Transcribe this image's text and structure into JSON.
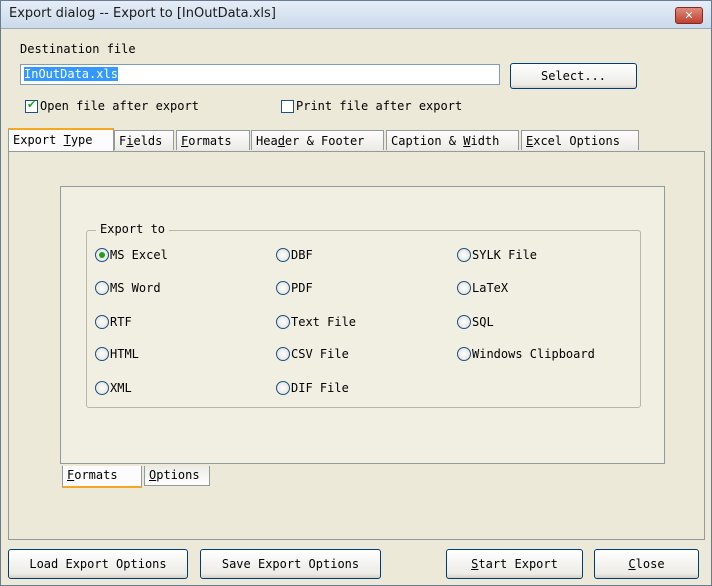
{
  "window": {
    "title": "Export dialog -- Export to [InOutData.xls]",
    "close_glyph": "✕"
  },
  "destination": {
    "label": "Destination file",
    "value": "InOutData.xls",
    "select_button": "Select..."
  },
  "options": {
    "open_after": {
      "label": "Open file after export",
      "checked": true
    },
    "print_after": {
      "label": "Print file after export",
      "checked": false
    }
  },
  "tabs": [
    {
      "pre": "Export ",
      "ul": "T",
      "post": "ype",
      "active": true
    },
    {
      "pre": "F",
      "ul": "i",
      "post": "elds",
      "active": false
    },
    {
      "pre": "",
      "ul": "F",
      "post": "ormats",
      "active": false
    },
    {
      "pre": "Hea",
      "ul": "d",
      "post": "er & Footer",
      "active": false
    },
    {
      "pre": "Caption & ",
      "ul": "W",
      "post": "idth",
      "active": false
    },
    {
      "pre": "",
      "ul": "E",
      "post": "xcel Options",
      "active": false
    }
  ],
  "export_to": {
    "legend": "Export to",
    "selected": "MS Excel",
    "items": [
      "MS Excel",
      "MS Word",
      "RTF",
      "HTML",
      "XML",
      "DBF",
      "PDF",
      "Text File",
      "CSV File",
      "DIF File",
      "SYLK File",
      "LaTeX",
      "SQL",
      "Windows Clipboard"
    ]
  },
  "subtabs": [
    {
      "ul": "F",
      "post": "ormats",
      "active": true
    },
    {
      "ul": "O",
      "post": "ptions",
      "active": false
    }
  ],
  "footer": {
    "load": "Load Export Options",
    "save": "Save Export Options",
    "start": {
      "ul": "S",
      "post": "tart Export"
    },
    "close": {
      "ul": "C",
      "post": "lose"
    }
  }
}
